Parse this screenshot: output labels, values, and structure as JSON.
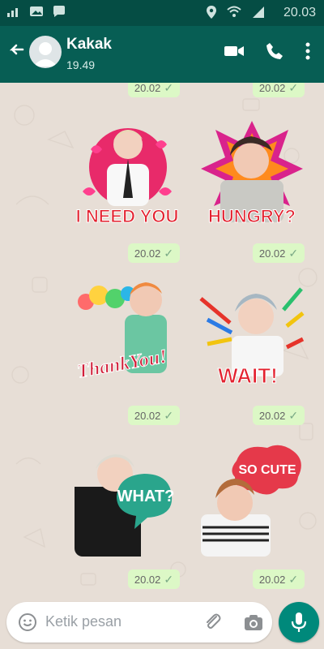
{
  "status_bar": {
    "time": "20.03",
    "icons": [
      "signal-icon",
      "image-icon",
      "chat-bubble-icon",
      "location-icon",
      "wifi-icon",
      "cellular-signal-icon"
    ]
  },
  "header": {
    "contact_name": "Kakak",
    "subtitle": "19.49",
    "icons": {
      "back": "back-arrow-icon",
      "video": "video-call-icon",
      "call": "phone-icon",
      "menu": "more-vert-icon"
    }
  },
  "messages": [
    {
      "id": "m0",
      "time": "20.02",
      "status": "sent",
      "sticker_text": ""
    },
    {
      "id": "m1",
      "time": "20.02",
      "status": "sent",
      "sticker_text": ""
    },
    {
      "id": "s1",
      "time": "20.02",
      "status": "sent",
      "sticker_text": "I NEED YOU"
    },
    {
      "id": "s2",
      "time": "20.02",
      "status": "sent",
      "sticker_text": "HUNGRY?"
    },
    {
      "id": "s3",
      "time": "20.02",
      "status": "sent",
      "sticker_text": "ThankYou!"
    },
    {
      "id": "s4",
      "time": "20.02",
      "status": "sent",
      "sticker_text": "WAIT!"
    },
    {
      "id": "s5",
      "time": "20.02",
      "status": "sent",
      "sticker_text": "WHAT?"
    },
    {
      "id": "s6",
      "time": "20.02",
      "status": "sent",
      "sticker_text": "SO CUTE"
    }
  ],
  "composer": {
    "placeholder": "Ketik pesan",
    "icons": {
      "emoji": "emoji-icon",
      "attach": "paperclip-icon",
      "camera": "camera-icon",
      "mic": "microphone-icon"
    }
  },
  "colors": {
    "header": "#075e54",
    "status_bar": "#054d44",
    "outgoing_bubble": "#dcf8c6",
    "fab": "#00897b",
    "chat_bg": "#e7ded6"
  }
}
